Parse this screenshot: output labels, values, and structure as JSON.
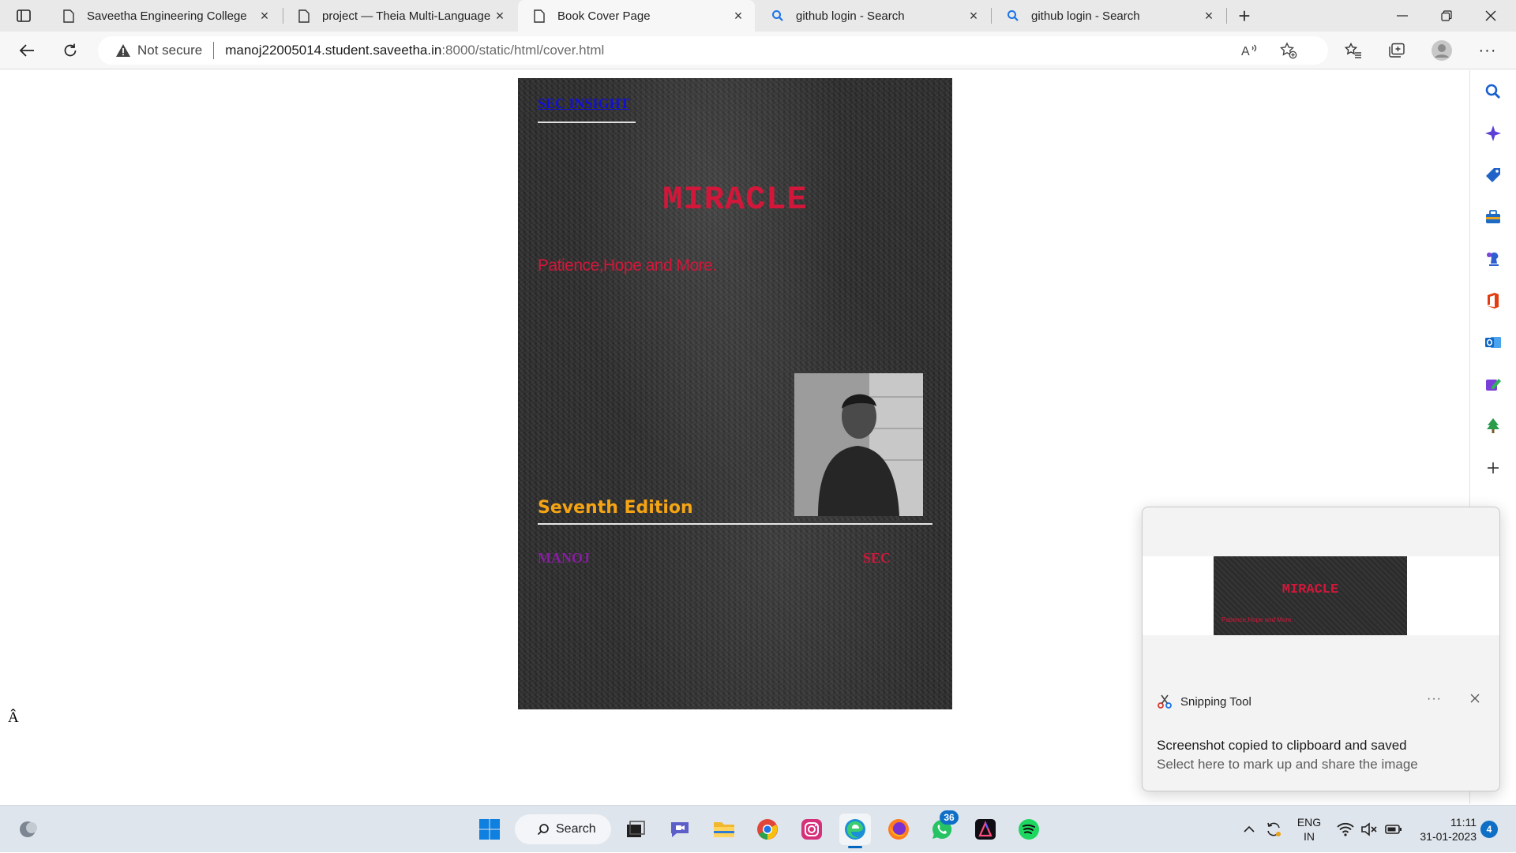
{
  "browser": {
    "tabs": [
      {
        "title": "Saveetha Engineering College",
        "icon": "page-icon"
      },
      {
        "title": "project — Theia Multi-Language",
        "icon": "page-icon"
      },
      {
        "title": "Book Cover Page",
        "icon": "page-icon",
        "active": true
      },
      {
        "title": "github login - Search",
        "icon": "search-icon"
      },
      {
        "title": "github login - Search",
        "icon": "search-icon"
      }
    ],
    "address": {
      "security_label": "Not secure",
      "host": "manoj22005014.student.saveetha.in",
      "path": ":8000/static/html/cover.html"
    }
  },
  "page": {
    "stray_glyph": "Â"
  },
  "cover": {
    "brand": "SEC INSIGHT",
    "title": "MIRACLE",
    "subtitle": "Patience,Hope and More.",
    "edition": "Seventh Edition",
    "author": "MANOJ",
    "publisher": "SEC",
    "colors": {
      "brand": "#1010d8",
      "title": "#d3173a",
      "edition": "#f5a414",
      "author": "#8a1da3"
    }
  },
  "notification": {
    "app": "Snipping Tool",
    "more": "···",
    "heading": "Screenshot copied to clipboard and saved",
    "body": "Select here to mark up and share the image",
    "thumb_title": "MIRACLE",
    "thumb_subtitle": "Patience,Hope and More."
  },
  "taskbar": {
    "search_label": "Search",
    "whatsapp_badge": "36",
    "language_line1": "ENG",
    "language_line2": "IN",
    "time": "11:11",
    "date": "31-01-2023",
    "notification_count": "4"
  }
}
